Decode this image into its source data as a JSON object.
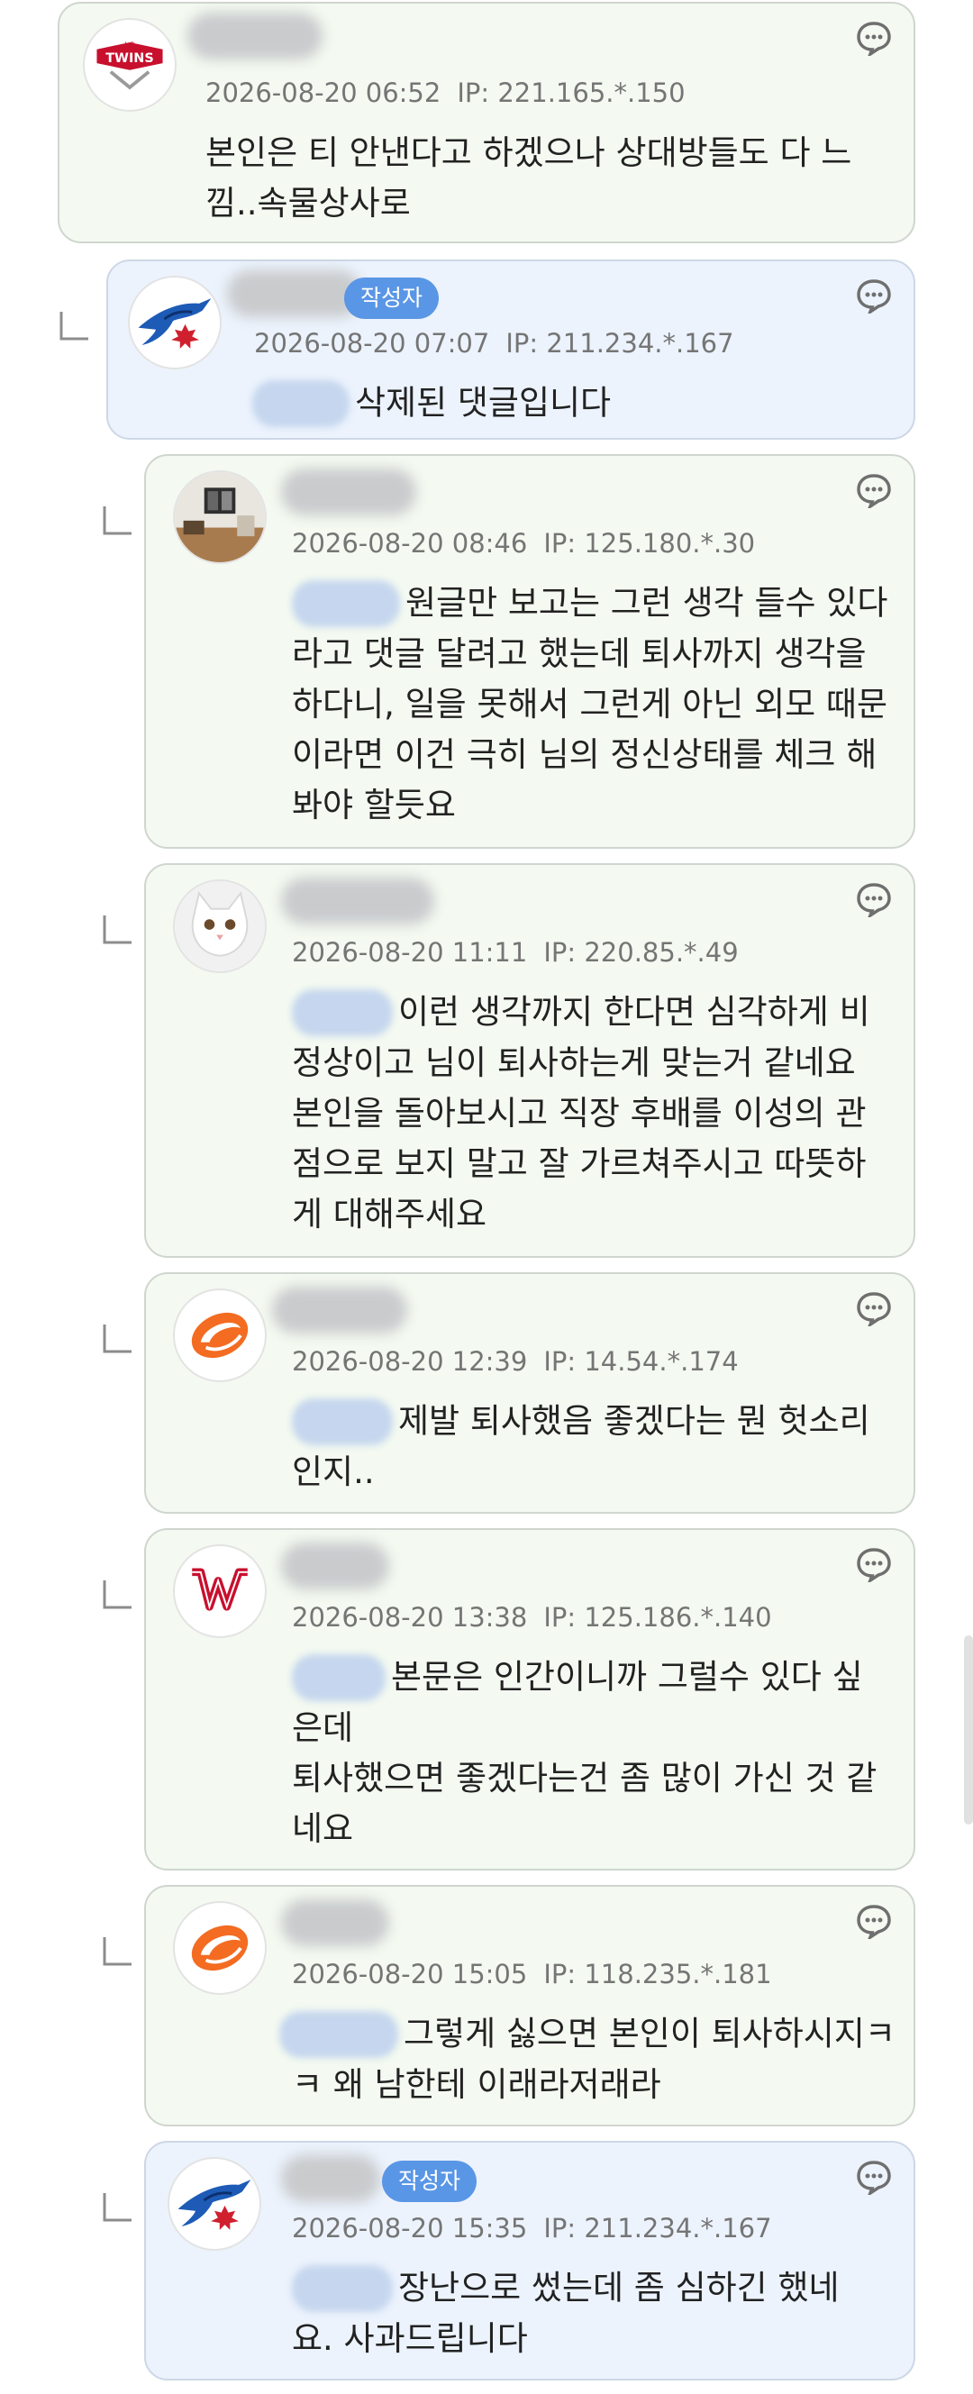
{
  "comments": [
    {
      "time": "2026-08-20 06:52",
      "ip": "IP: 221.165.*.150",
      "lines": [
        "본인은 티 안낸다고 하겠으나 상대방들도 다 느",
        "낌..속물상사로"
      ],
      "avatar": "lg-twins-logo",
      "avatar_text": "TWINS",
      "avatar_small": "LG",
      "author_badge": null,
      "deleted": false
    },
    {
      "time": "2026-08-20 07:07",
      "ip": "IP: 211.234.*.167",
      "lines": [
        "삭제된 댓글입니다"
      ],
      "avatar": "blue-jays-logo",
      "author_badge": "작성자",
      "deleted": true
    },
    {
      "time": "2026-08-20 08:46",
      "ip": "IP: 125.180.*.30",
      "lines": [
        "원글만 보고는 그런 생각 들수 있다",
        "라고 댓글 달려고 했는데 퇴사까지 생각을",
        "하다니, 일을 못해서 그런게 아닌 외모 때문",
        "이라면 이건 극히 님의 정신상태를 체크 해",
        "봐야 할듯요"
      ],
      "avatar": "room-photo",
      "author_badge": null,
      "deleted": false
    },
    {
      "time": "2026-08-20 11:11",
      "ip": "IP: 220.85.*.49",
      "lines": [
        "이런 생각까지 한다면 심각하게 비",
        "정상이고 님이 퇴사하는게 맞는거 같네요",
        "본인을 돌아보시고 직장 후배를 이성의 관",
        "점으로 보지 말고 잘 가르쳐주시고 따뜻하",
        "게 대해주세요"
      ],
      "avatar": "cat-photo",
      "author_badge": null,
      "deleted": false
    },
    {
      "time": "2026-08-20 12:39",
      "ip": "IP: 14.54.*.174",
      "lines": [
        "제발 퇴사했음 좋겠다는 뭔 헛소리",
        "인지.."
      ],
      "avatar": "orange-swirl-logo",
      "author_badge": null,
      "deleted": false
    },
    {
      "time": "2026-08-20 13:38",
      "ip": "IP: 125.186.*.140",
      "lines": [
        "본문은 인간이니까 그럴수 있다 싶",
        "은데",
        "퇴사했으면 좋겠다는건 좀 많이 가신 것 같",
        "네요"
      ],
      "avatar": "nationals-logo",
      "author_badge": null,
      "deleted": false
    },
    {
      "time": "2026-08-20 15:05",
      "ip": "IP: 118.235.*.181",
      "lines": [
        "그렇게 싫으면 본인이 퇴사하시지ㅋ",
        "ㅋ 왜 남한테 이래라저래라"
      ],
      "avatar": "orange-swirl-logo",
      "author_badge": null,
      "deleted": false
    },
    {
      "time": "2026-08-20 15:35",
      "ip": "IP: 211.234.*.167",
      "lines": [
        "장난으로 썼는데 좀 심하긴 했네",
        "요. 사과드립니다"
      ],
      "avatar": "blue-jays-logo",
      "author_badge": "작성자",
      "deleted": false
    }
  ],
  "icons": {
    "comment_menu": "speech-bubble-icon",
    "reply": "reply-arrow-icon"
  },
  "colors": {
    "card_green": "#f4faf1",
    "card_blue": "#ecf3fd",
    "badge": "#5a96e6",
    "meta": "#757575"
  }
}
